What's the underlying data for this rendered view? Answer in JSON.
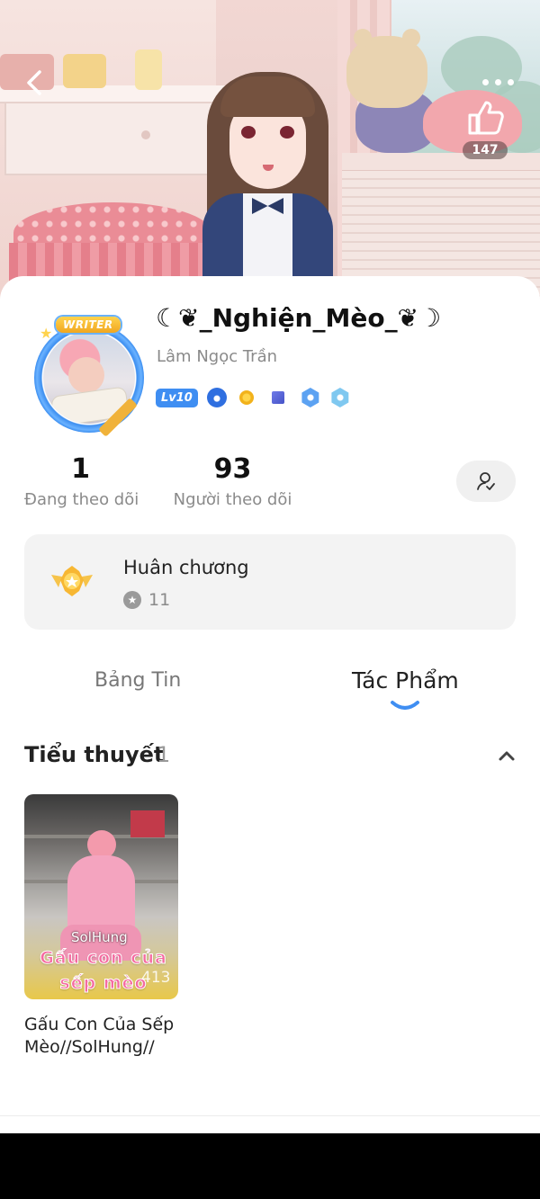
{
  "header": {
    "like_count": "147"
  },
  "profile": {
    "username": "☾❦_Nghiện_Mèo_❦☽",
    "real_name": "Lâm Ngọc Trần",
    "avatar_badge": "WRITER",
    "level": "Lv10",
    "badge_icons": [
      "drop-badge-icon",
      "coin-badge-icon",
      "flag-badge-icon",
      "hexagon-badge-icon",
      "star-hexagon-badge-icon"
    ]
  },
  "stats": {
    "following_count": "1",
    "following_label": "Đang theo dõi",
    "followers_count": "93",
    "followers_label": "Người theo dõi"
  },
  "medals": {
    "title": "Huân chương",
    "count": "11"
  },
  "tabs": [
    {
      "label": "Bảng Tin",
      "active": false
    },
    {
      "label": "Tác Phẩm",
      "active": true
    }
  ],
  "section": {
    "title": "Tiểu thuyết",
    "count": "1"
  },
  "books": [
    {
      "title": "Gấu Con Của Sếp Mèo//SolHung//",
      "cover_title": "Gấu con của sếp mèo",
      "cover_watermark": "SolHung",
      "views": "413"
    }
  ],
  "colors": {
    "accent": "#3f8ef2",
    "card_bg": "#ffffff",
    "muted_text": "#8a8a8a"
  }
}
